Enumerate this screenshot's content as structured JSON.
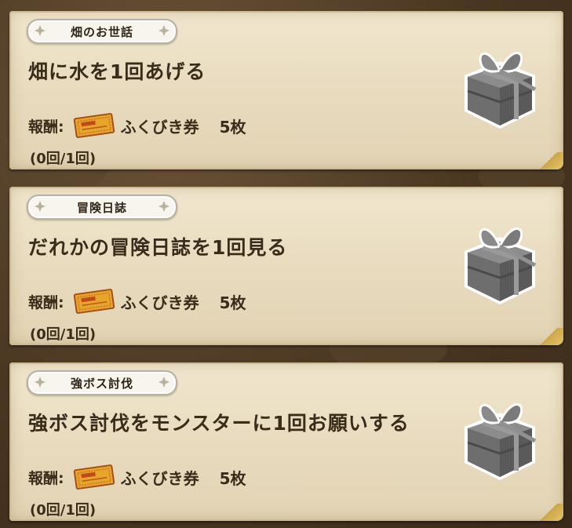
{
  "missions": [
    {
      "tag": "畑のお世話",
      "title": "畑に水を1回あげる",
      "reward_label": "報酬:",
      "reward_item": "ふくびき券",
      "reward_qty": "5枚",
      "progress": "(0回/1回)"
    },
    {
      "tag": "冒険日誌",
      "title": "だれかの冒険日誌を1回見る",
      "reward_label": "報酬:",
      "reward_item": "ふくびき券",
      "reward_qty": "5枚",
      "progress": "(0回/1回)"
    },
    {
      "tag": "強ボス討伐",
      "title": "強ボス討伐をモンスターに1回お願いする",
      "reward_label": "報酬:",
      "reward_item": "ふくびき券",
      "reward_qty": "5枚",
      "progress": "(0回/1回)"
    }
  ],
  "icons": {
    "reward": "fukubiki-ticket-icon",
    "gift": "gift-box-icon"
  },
  "colors": {
    "card": "#ebdfc4",
    "text": "#3a2c1b",
    "ticket": "#e8a52a",
    "gift": "#6e6e6e"
  }
}
